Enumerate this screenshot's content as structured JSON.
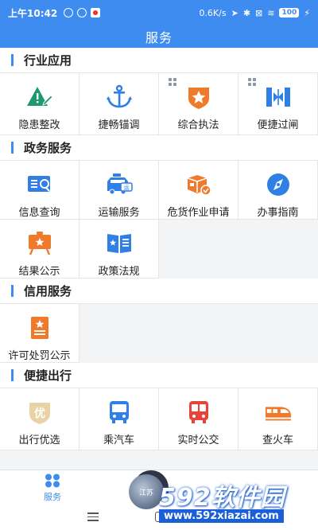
{
  "statusbar": {
    "time": "上午10:42",
    "speed": "0.6K/s",
    "battery": "100"
  },
  "navbar": {
    "title": "服务"
  },
  "sections": [
    {
      "title": "行业应用",
      "items": [
        {
          "label": "隐患整改",
          "icon": "hazard-icon"
        },
        {
          "label": "捷畅锚调",
          "icon": "anchor-icon"
        },
        {
          "label": "综合执法",
          "icon": "badge-star-icon"
        },
        {
          "label": "便捷过闸",
          "icon": "lock-gate-icon"
        }
      ]
    },
    {
      "title": "政务服务",
      "items": [
        {
          "label": "信息查询",
          "icon": "info-search-icon"
        },
        {
          "label": "运输服务",
          "icon": "transport-car-icon"
        },
        {
          "label": "危货作业申请",
          "icon": "hazmat-box-icon"
        },
        {
          "label": "办事指南",
          "icon": "compass-icon"
        },
        {
          "label": "结果公示",
          "icon": "easel-icon"
        },
        {
          "label": "政策法规",
          "icon": "book-icon"
        }
      ]
    },
    {
      "title": "信用服务",
      "items": [
        {
          "label": "许可处罚公示",
          "icon": "document-star-icon"
        }
      ]
    },
    {
      "title": "便捷出行",
      "items": [
        {
          "label": "出行优选",
          "icon": "shield-you-icon"
        },
        {
          "label": "乘汽车",
          "icon": "bus-icon"
        },
        {
          "label": "实时公交",
          "icon": "realtime-bus-icon"
        },
        {
          "label": "查火车",
          "icon": "train-icon"
        }
      ]
    }
  ],
  "tabbar": {
    "service_label": "服务",
    "mid_label": "江苏"
  },
  "watermark": {
    "brand": "592软件园",
    "url": "www.592xiazai.com"
  },
  "colors": {
    "primary": "#3f8cf0",
    "orange": "#f07a2c",
    "green": "#1e9a6c",
    "red": "#e8433a"
  }
}
